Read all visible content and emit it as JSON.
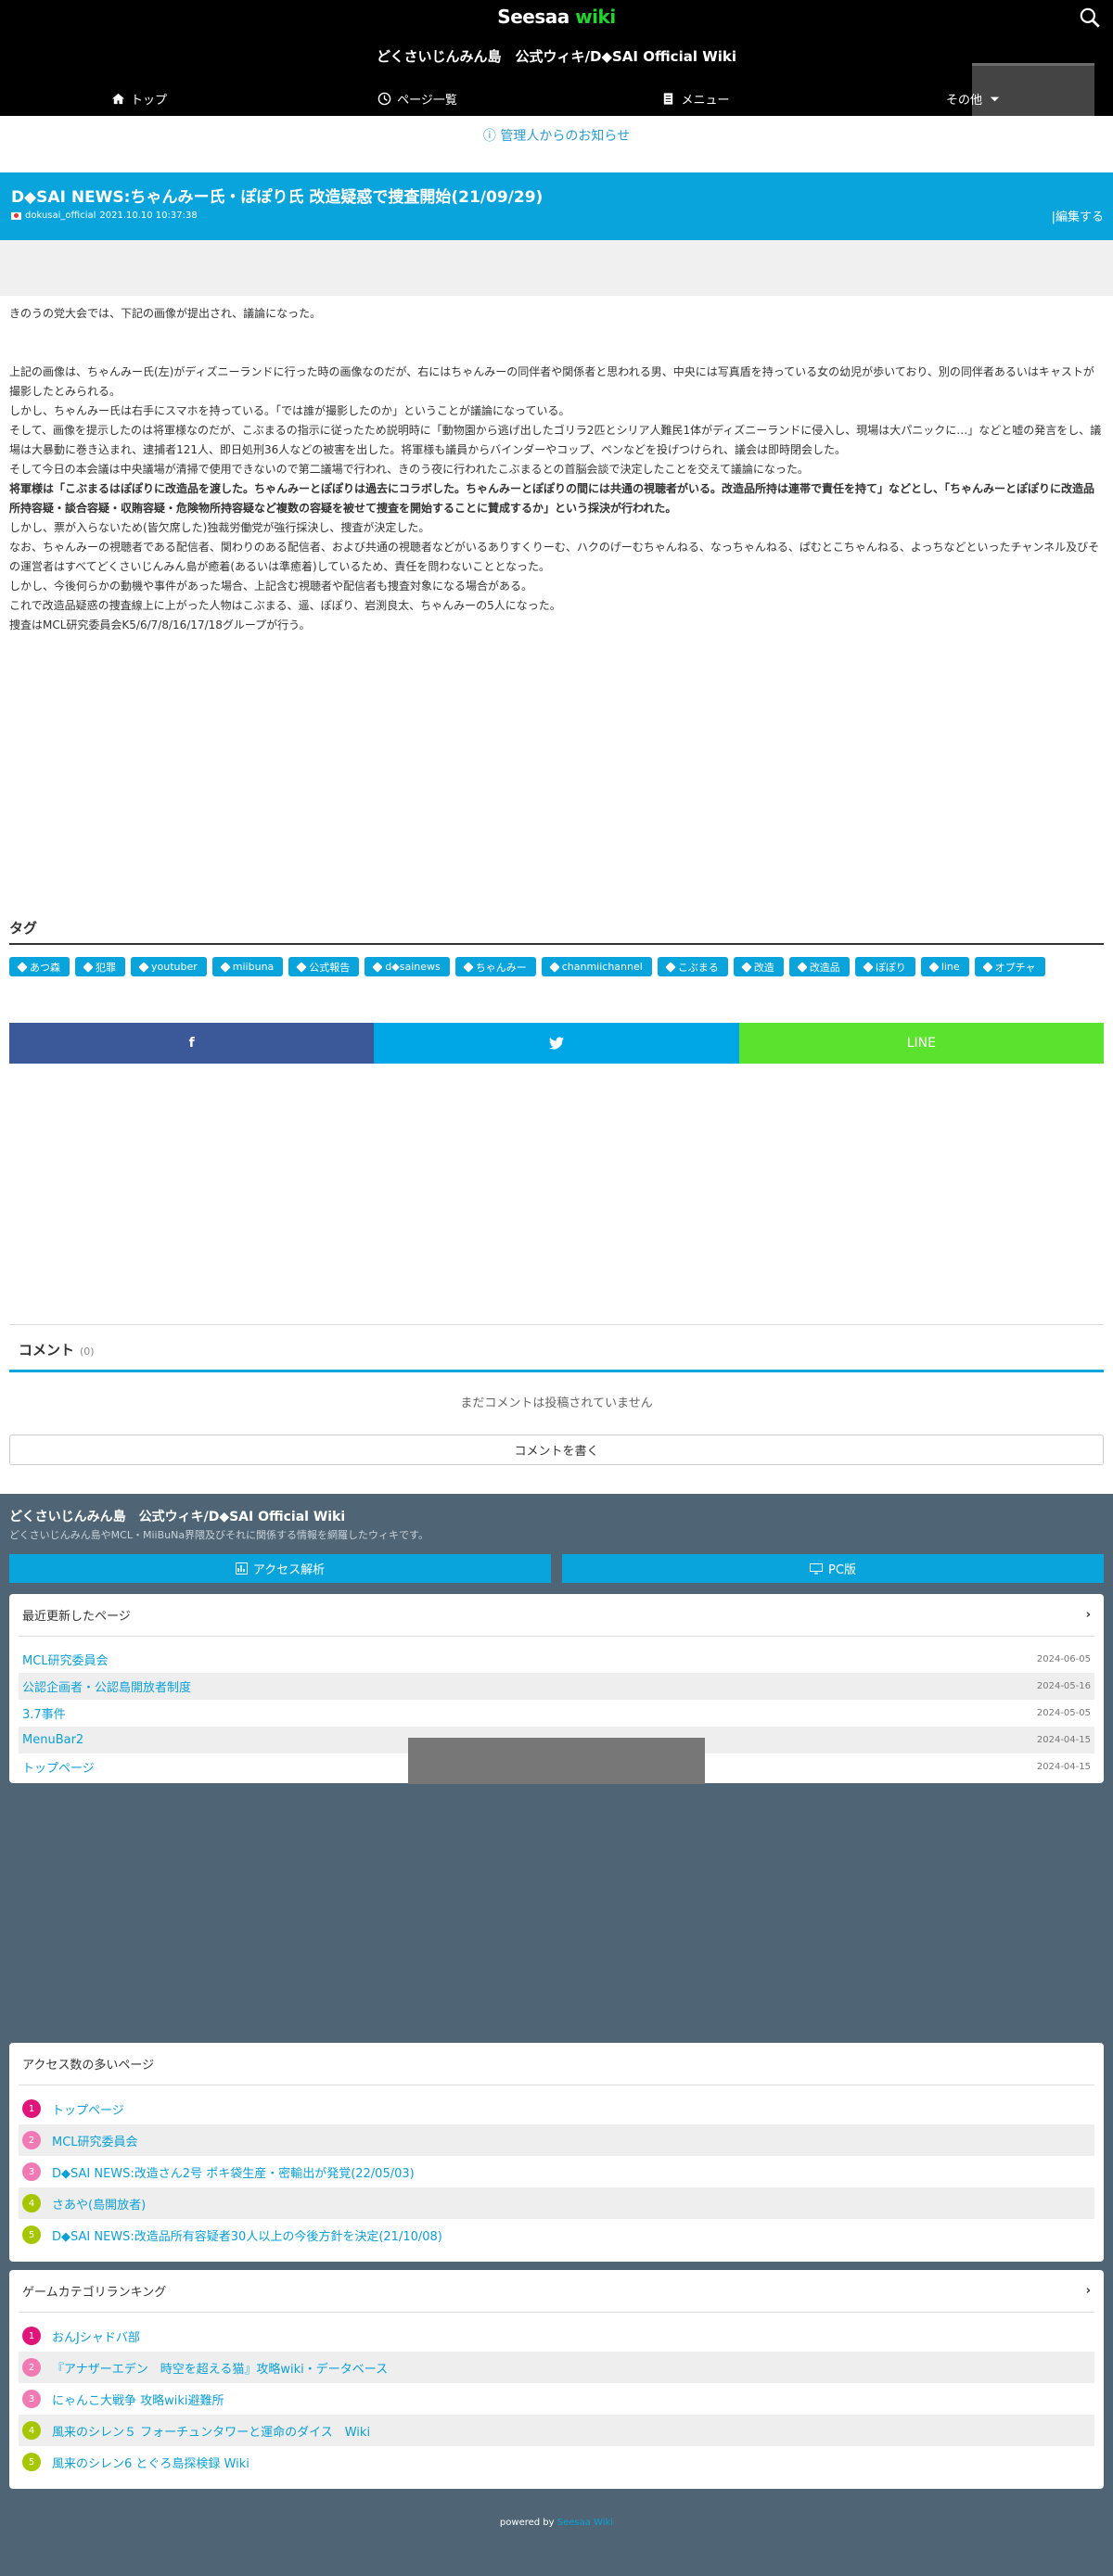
{
  "header": {
    "logo_main": "Seesaa",
    "logo_sub": "wiki",
    "site_title": "どくさいじんみん島　公式ウィキ/D◆SAI Official Wiki",
    "nav": [
      {
        "label": "トップ",
        "icon": "home-icon"
      },
      {
        "label": "ページ一覧",
        "icon": "clock-icon"
      },
      {
        "label": "メニュー",
        "icon": "document-icon"
      },
      {
        "label": "その他",
        "icon": "caret-down-icon"
      }
    ]
  },
  "notice": "ⓘ 管理人からのお知らせ",
  "article": {
    "title": "D◆SAI NEWS:ちゃんみー氏・ぽぽり氏 改造疑惑で捜査開始(21/09/29)",
    "author": "dokusai_official",
    "date": "2021.10.10 10:37:38",
    "edit": "編集する",
    "lines": [
      "きのうの党大会では、下記の画像が提出され、議論になった。",
      "",
      "",
      "上記の画像は、ちゃんみー氏(左)がディズニーランドに行った時の画像なのだが、右にはちゃんみーの同伴者や関係者と思われる男、中央には写真盾を持っている女の幼児が歩いており、別の同伴者あるいはキャストが撮影したとみられる。",
      "しかし、ちゃんみー氏は右手にスマホを持っている。「では誰が撮影したのか」ということが議論になっている。",
      "そして、画像を提示したのは将軍様なのだが、こぶまるの指示に従ったため説明時に「動物園から逃げ出したゴリラ2匹とシリア人難民1体がディズニーランドに侵入し、現場は大パニックに…」などと嘘の発言をし、議場は大暴動に巻き込まれ、逮捕者121人、即日処刑36人などの被害を出した。将軍様も議員からバインダーやコップ、ペンなどを投げつけられ、議会は即時閉会した。",
      "そして今日の本会議は中央議場が清掃で使用できないので第二議場で行われ、きのう夜に行われたこぶまるとの首脳会談で決定したことを交えて議論になった。",
      "将軍様は「こぶまるはぽぽりに改造品を渡した。ちゃんみーとぽぽりは過去にコラボした。ちゃんみーとぽぽりの間には共通の視聴者がいる。改造品所持は連帯で責任を持て」などとし、「ちゃんみーとぽぽりに改造品所持容疑・談合容疑・収賄容疑・危険物所持容疑など複数の容疑を被せて捜査を開始することに賛成するか」という採決が行われた。",
      "しかし、票が入らないため(皆欠席した)独裁労働党が強行採決し、捜査が決定した。",
      "なお、ちゃんみーの視聴者である配信者、関わりのある配信者、および共通の視聴者などがいるありすくりーむ、ハクのげーむちゃんねる、なっちゃんねる、ぱむとこちゃんねる、よっちなどといったチャンネル及びその運営者はすべてどくさいじんみん島が癒着(あるいは準癒着)しているため、責任を問わないこととなった。",
      "しかし、今後何らかの動機や事件があった場合、上記含む視聴者や配信者も捜査対象になる場合がある。",
      "これで改造品疑惑の捜査線上に上がった人物はこぶまる、遥、ぽぽり、岩渕良太、ちゃんみーの5人になった。",
      "捜査はMCL研究委員会K5/6/7/8/16/17/18グループが行う。"
    ]
  },
  "tags": {
    "heading": "タグ",
    "items": [
      "あつ森",
      "犯罪",
      "youtuber",
      "miibuna",
      "公式報告",
      "d◆sainews",
      "ちゃんみー",
      "chanmiichannel",
      "こぶまる",
      "改造",
      "改造品",
      "ぽぽり",
      "line",
      "オプチャ"
    ]
  },
  "share": {
    "facebook": "f",
    "twitter": "twitter",
    "line": "LINE"
  },
  "comments": {
    "heading": "コメント",
    "count": "(0)",
    "empty": "まだコメントは投稿されていません",
    "write": "コメントを書く"
  },
  "footer": {
    "title": "どくさいじんみん島　公式ウィキ/D◆SAI Official Wiki",
    "desc": "どくさいじんみん島やMCL・MiiBuNa界隈及びそれに関係する情報を網羅したウィキです。",
    "access_btn": "アクセス解析",
    "pc_btn": "PC版",
    "recent": {
      "heading": "最近更新したページ",
      "items": [
        {
          "t": "MCL研究委員会",
          "d": "2024-06-05"
        },
        {
          "t": "公認企画者・公認島開放者制度",
          "d": "2024-05-16"
        },
        {
          "t": "3.7事件",
          "d": "2024-05-05"
        },
        {
          "t": "MenuBar2",
          "d": "2024-04-15"
        },
        {
          "t": "トップページ",
          "d": "2024-04-15"
        }
      ]
    },
    "popular": {
      "heading": "アクセス数の多いページ",
      "items": [
        "トップページ",
        "MCL研究委員会",
        "D◆SAI NEWS:改造さん2号 ポキ袋生産・密輸出が発覚(22/05/03)",
        "さあや(島開放者)",
        "D◆SAI NEWS:改造品所有容疑者30人以上の今後方針を決定(21/10/08)"
      ]
    },
    "game": {
      "heading": "ゲームカテゴリランキング",
      "items": [
        "おんJシャドバ部",
        "『アナザーエデン　時空を超える猫』攻略wiki・データベース",
        "にゃんこ大戦争 攻略wiki避難所",
        "風来のシレン５ フォーチュンタワーと運命のダイス　Wiki",
        "風来のシレン6 とぐろ島探検録 Wiki"
      ]
    },
    "rank_colors": [
      "#e0157a",
      "#f07ab4",
      "#f07ab4",
      "#a6c600",
      "#a6c600"
    ],
    "powered": "powered by",
    "powered_link": "Seesaa Wiki"
  }
}
